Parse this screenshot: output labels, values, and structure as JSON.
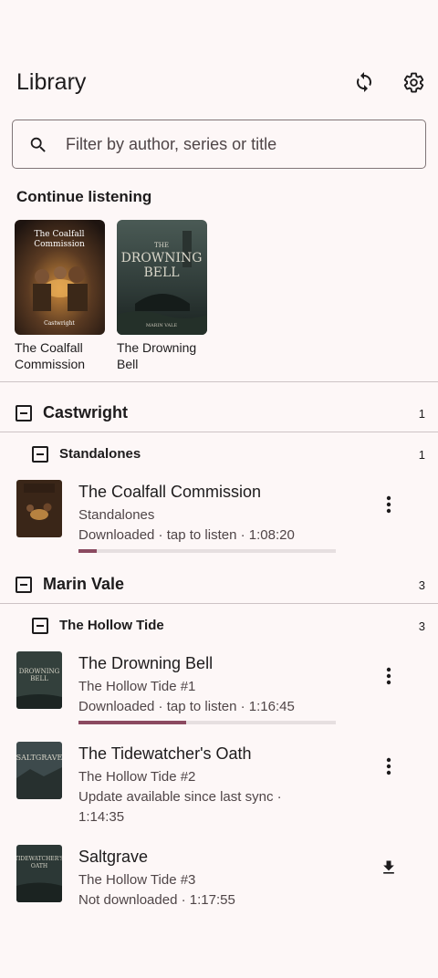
{
  "header": {
    "title": "Library",
    "sync_icon": "sync-icon",
    "settings_icon": "gear-icon"
  },
  "search": {
    "placeholder": "Filter by author, series or title",
    "value": ""
  },
  "continue_listening": {
    "title": "Continue listening",
    "items": [
      {
        "label": "The Coalfall Commission",
        "cover_title": "The Coalfall Commission",
        "cover_author": "Castwright"
      },
      {
        "label": "The Drowning Bell",
        "cover_title": "THE DROWNING BELL",
        "cover_author": "MARIN VALE"
      }
    ]
  },
  "authors": [
    {
      "name": "Castwright",
      "count": "1",
      "series": [
        {
          "name": "Standalones",
          "count": "1",
          "books": [
            {
              "title": "The Coalfall Commission",
              "series": "Standalones",
              "status": "Downloaded · tap to listen · 1:08:20",
              "progress": 0.07,
              "action": "more-icon"
            }
          ]
        }
      ]
    },
    {
      "name": "Marin Vale",
      "count": "3",
      "series": [
        {
          "name": "The Hollow Tide",
          "count": "3",
          "books": [
            {
              "title": "The Drowning Bell",
              "series": "The Hollow Tide #1",
              "status": "Downloaded · tap to listen · 1:16:45",
              "progress": 0.42,
              "action": "more-icon"
            },
            {
              "title": "The Tidewatcher's Oath",
              "series": "The Hollow Tide #2",
              "status": "Update available since last sync · 1:14:35",
              "action": "more-icon"
            },
            {
              "title": "Saltgrave",
              "series": "The Hollow Tide #3",
              "status": "Not downloaded · 1:17:55",
              "action": "download-icon"
            }
          ]
        }
      ]
    }
  ],
  "colors": {
    "background": "#fdf7f7",
    "accent": "#8b4a60",
    "divider": "#cdc3c5"
  }
}
